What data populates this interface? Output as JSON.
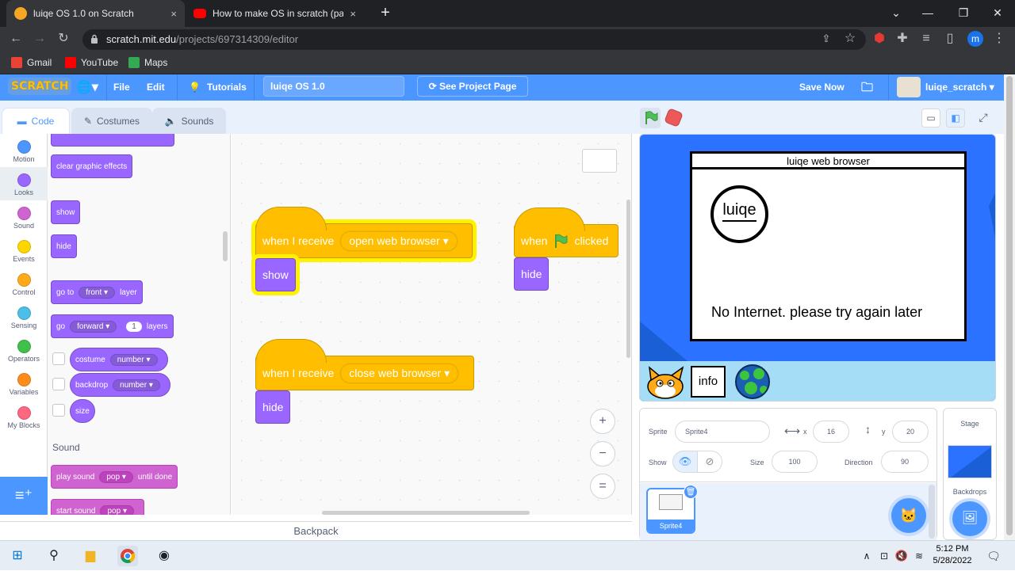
{
  "browser": {
    "tabs": [
      {
        "title": "luiqe OS 1.0 on Scratch",
        "close": "×"
      },
      {
        "title": "How to make OS in scratch (part",
        "close": "×"
      }
    ],
    "new_tab": "+",
    "url_host": "scratch.mit.edu",
    "url_path": "/projects/697314309/editor",
    "profile_initial": "m",
    "bookmarks": [
      "Gmail",
      "YouTube",
      "Maps"
    ],
    "window_controls": {
      "minimize": "⌄",
      "restore": "—",
      "maximize": "❐",
      "close": "✕"
    }
  },
  "scratch_menu": {
    "logo": "SCRATCH",
    "file": "File",
    "edit": "Edit",
    "tutorials": "Tutorials",
    "project_title": "luiqe OS 1.0",
    "see_project_page": "See Project Page",
    "save_now": "Save Now",
    "username": "luiqe_scratch"
  },
  "editor_tabs": {
    "code": "Code",
    "costumes": "Costumes",
    "sounds": "Sounds"
  },
  "categories": [
    {
      "label": "Motion",
      "color": "#4c97ff"
    },
    {
      "label": "Looks",
      "color": "#9966ff"
    },
    {
      "label": "Sound",
      "color": "#cf63cf"
    },
    {
      "label": "Events",
      "color": "#ffd500"
    },
    {
      "label": "Control",
      "color": "#ffab19"
    },
    {
      "label": "Sensing",
      "color": "#4cbfe6"
    },
    {
      "label": "Operators",
      "color": "#40bf4a"
    },
    {
      "label": "Variables",
      "color": "#ff8c1a"
    },
    {
      "label": "My Blocks",
      "color": "#ff6680"
    }
  ],
  "palette": {
    "clear_graphic_effects": "clear graphic effects",
    "show": "show",
    "hide": "hide",
    "go_to": "go to",
    "front": "front",
    "layer": "layer",
    "go": "go",
    "forward": "forward",
    "one": "1",
    "layers": "layers",
    "costume": "costume",
    "backdrop": "backdrop",
    "number": "number",
    "size": "size",
    "sound_heading": "Sound",
    "play_sound": "play sound",
    "pop": "pop",
    "until_done": "until done",
    "start_sound": "start sound"
  },
  "scripts": {
    "s1": {
      "hat": "when I receive",
      "message": "open web browser",
      "block": "show"
    },
    "s2": {
      "hat": "when",
      "clicked": "clicked",
      "block": "hide"
    },
    "s3": {
      "hat": "when I receive",
      "message": "close web browser",
      "block": "hide"
    }
  },
  "zoom": {
    "in": "+",
    "out": "−",
    "reset": "="
  },
  "backpack": "Backpack",
  "stage_canvas": {
    "browser_title": "luiqe web browser",
    "logo": "luiqe",
    "message": "No Internet. please try again later",
    "info": "info"
  },
  "sprite_info": {
    "sprite_label": "Sprite",
    "sprite_name": "Sprite4",
    "x_label": "x",
    "x": "16",
    "y_label": "y",
    "y": "20",
    "show_label": "Show",
    "size_label": "Size",
    "size": "100",
    "direction_label": "Direction",
    "direction": "90",
    "thumb_name": "Sprite4"
  },
  "stage_pane": {
    "label": "Stage",
    "backdrops": "Backdrops"
  },
  "taskbar": {
    "time": "5:12 PM",
    "date": "5/28/2022"
  },
  "colors": {
    "scratch_blue": "#4c97ff",
    "events": "#ffbf00",
    "looks": "#9966ff",
    "sound": "#cf63cf",
    "glow": "#fff200"
  }
}
